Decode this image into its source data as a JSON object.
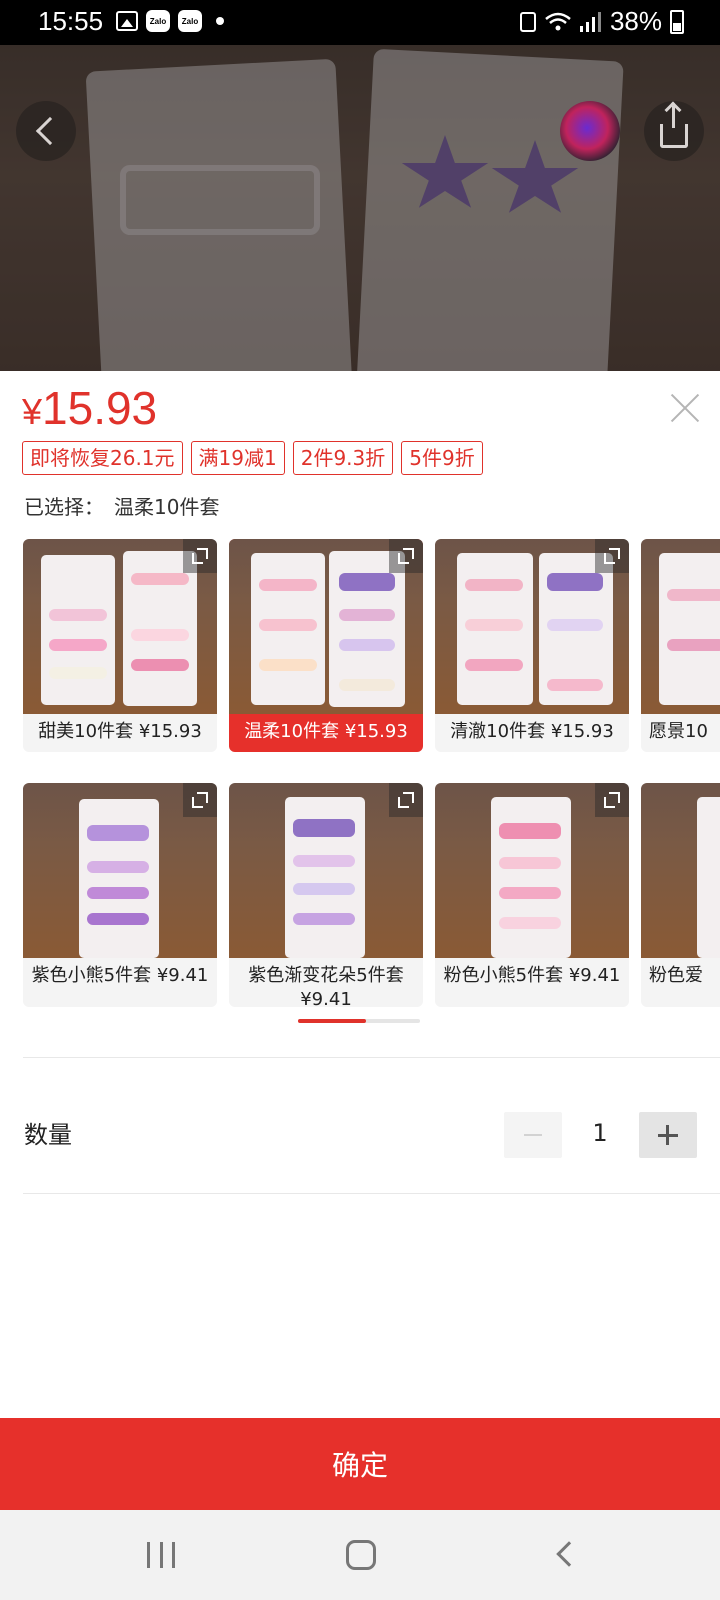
{
  "status_bar": {
    "time": "15:55",
    "battery": "38%",
    "zalo_label": "Zalo"
  },
  "price": {
    "currency": "¥",
    "value": "15.93"
  },
  "promo_tags": [
    "即将恢复26.1元",
    "满19减1",
    "2件9.3折",
    "5件9折"
  ],
  "selection": {
    "label": "已选择：",
    "value": "温柔10件套"
  },
  "variants": [
    {
      "label": "甜美10件套 ¥15.93",
      "selected": false
    },
    {
      "label": "温柔10件套 ¥15.93",
      "selected": true
    },
    {
      "label": "清澈10件套 ¥15.93",
      "selected": false
    },
    {
      "label": "愿景10",
      "selected": false
    },
    {
      "label": "紫色小熊5件套 ¥9.41",
      "selected": false
    },
    {
      "label": "紫色渐变花朵5件套 ¥9.41",
      "selected": false
    },
    {
      "label": "粉色小熊5件套 ¥9.41",
      "selected": false
    },
    {
      "label": "粉色爱",
      "selected": false
    }
  ],
  "variant_scroll_progress": 0.56,
  "quantity": {
    "label": "数量",
    "value": "1"
  },
  "confirm_label": "确定",
  "colors": {
    "accent_red": "#e6302b",
    "tag_red": "#e0322b"
  }
}
